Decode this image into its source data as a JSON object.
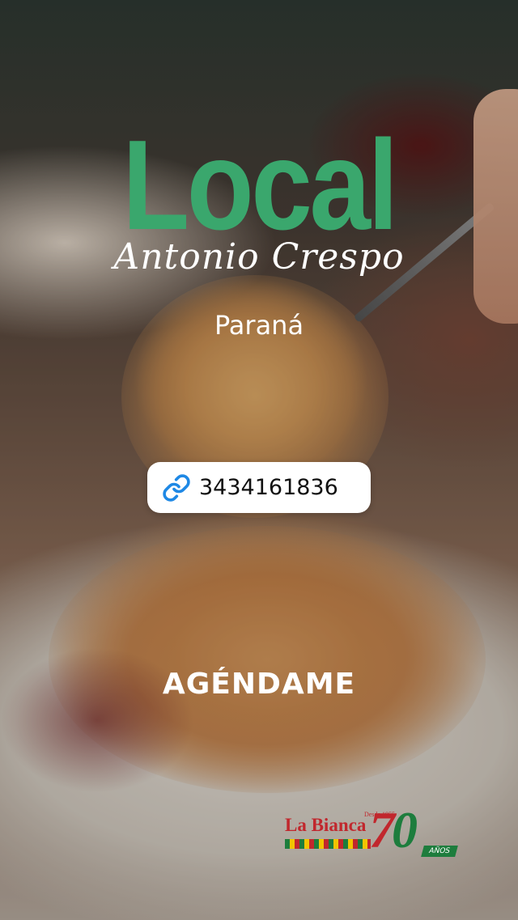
{
  "title": "Local",
  "subtitle": "Antonio Crespo",
  "city": "Paraná",
  "phone": {
    "number": "3434161836",
    "icon": "link-icon"
  },
  "cta": "AGÉNDAME",
  "logo": {
    "brand": "La Bianca",
    "since": "Desde 1955",
    "anniversary_seven": "7",
    "anniversary_zero": "0",
    "years": "AÑOS"
  },
  "colors": {
    "title": "#3aa76d",
    "text": "#ffffff",
    "button_bg": "#ffffff",
    "logo_red": "#c1272d",
    "logo_green": "#1d7d3d"
  }
}
